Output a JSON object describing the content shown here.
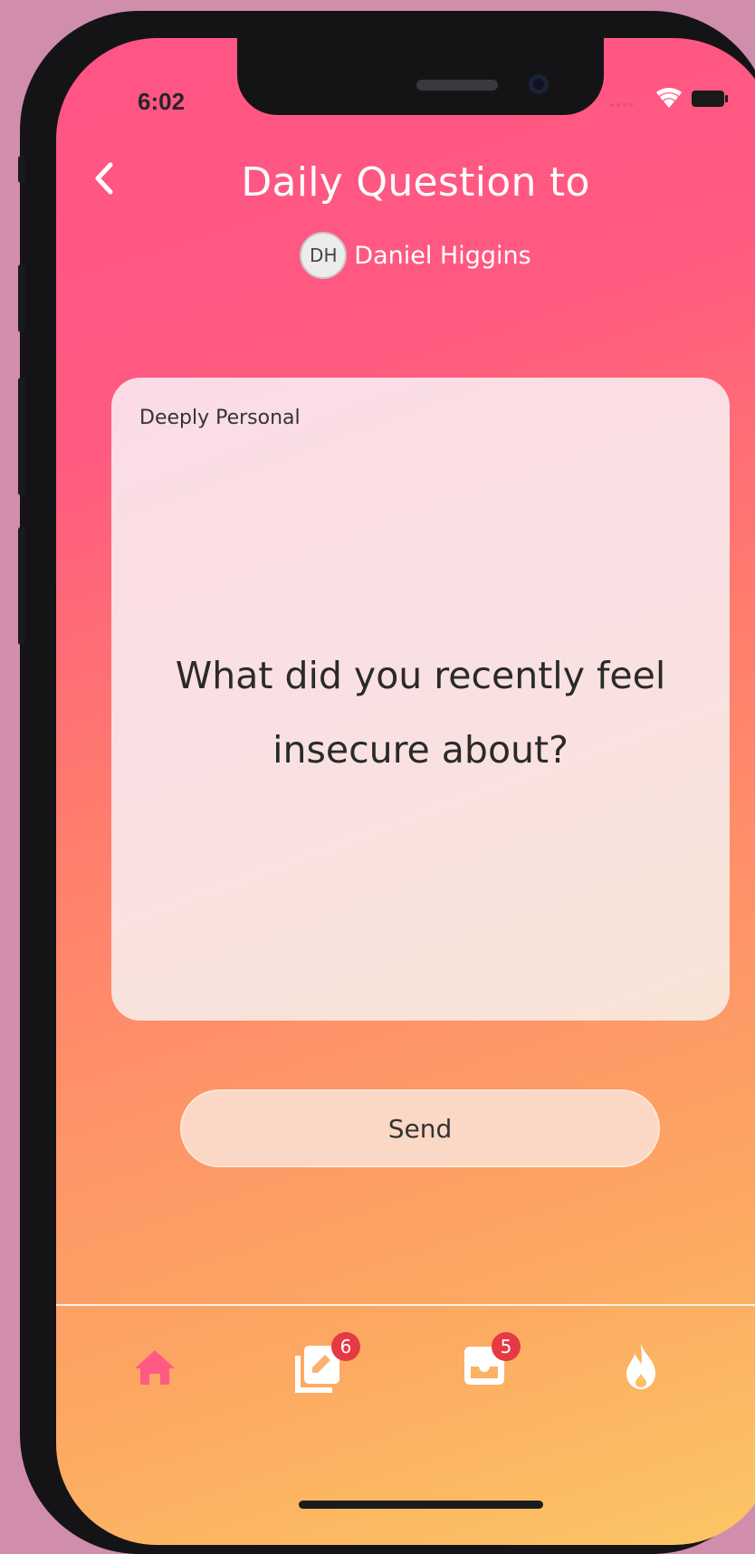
{
  "status_bar": {
    "time": "6:02"
  },
  "header": {
    "title": "Daily Question to",
    "recipient": {
      "initials": "DH",
      "name": "Daniel Higgins"
    }
  },
  "card": {
    "category": "Deeply Personal",
    "question": "What did you recently feel insecure about?"
  },
  "actions": {
    "send_label": "Send"
  },
  "tab_bar": {
    "items": [
      {
        "icon": "home-icon",
        "active": true
      },
      {
        "icon": "cards-icon",
        "badge": "6"
      },
      {
        "icon": "inbox-icon",
        "badge": "5"
      },
      {
        "icon": "flame-icon"
      }
    ]
  },
  "colors": {
    "gradient_top": "#ff5486",
    "gradient_bottom": "#fcc664",
    "active_tab": "#ff5a86",
    "badge": "#e53944"
  }
}
